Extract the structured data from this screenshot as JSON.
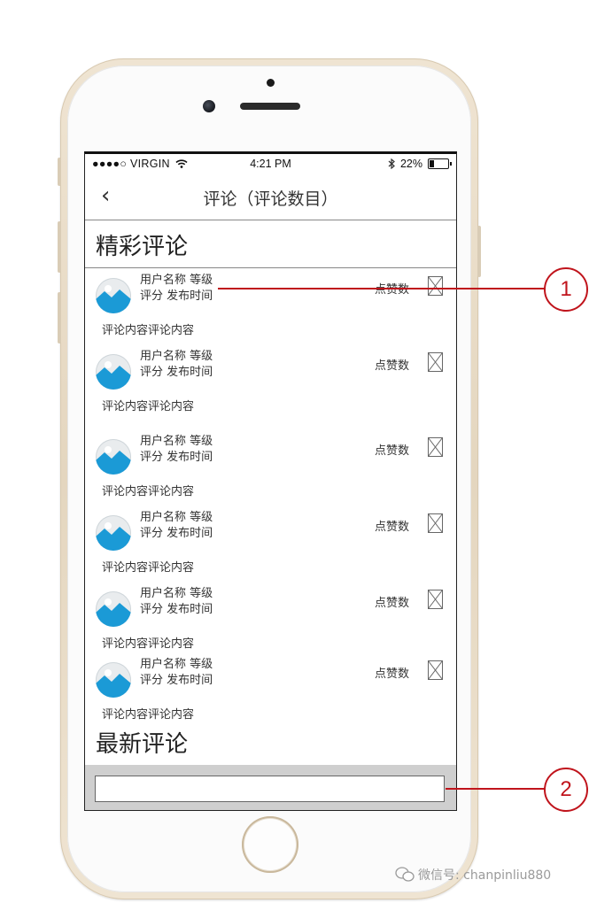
{
  "status_bar": {
    "carrier": "●●●●○ VIRGIN",
    "time": "4:21 PM",
    "battery": "22%"
  },
  "nav": {
    "back_icon": "chevron-left-icon",
    "title": "评论（评论数目）"
  },
  "sections": {
    "featured_title": "精彩评论",
    "latest_title": "最新评论"
  },
  "comments": [
    {
      "user_line": "用户名称 等级",
      "meta_line": "评分  发布时间",
      "likes_label": "点赞数",
      "text": "评论内容评论内容"
    },
    {
      "user_line": "用户名称 等级",
      "meta_line": "评分  发布时间",
      "likes_label": "点赞数",
      "text": "评论内容评论内容"
    },
    {
      "user_line": "用户名称 等级",
      "meta_line": "评分  发布时间",
      "likes_label": "点赞数",
      "text": "评论内容评论内容"
    },
    {
      "user_line": "用户名称 等级",
      "meta_line": "评分  发布时间",
      "likes_label": "点赞数",
      "text": "评论内容评论内容"
    },
    {
      "user_line": "用户名称 等级",
      "meta_line": "评分  发布时间",
      "likes_label": "点赞数",
      "text": "评论内容评论内容"
    },
    {
      "user_line": "用户名称 等级",
      "meta_line": "评分  发布时间",
      "likes_label": "点赞数",
      "text": "评论内容评论内容"
    }
  ],
  "input": {
    "value": "",
    "placeholder": ""
  },
  "callouts": [
    "1",
    "2"
  ],
  "watermark": "微信号: chanpinliu880",
  "colors": {
    "callout": "#c0141c",
    "avatar_blue": "#1b9ad6"
  }
}
